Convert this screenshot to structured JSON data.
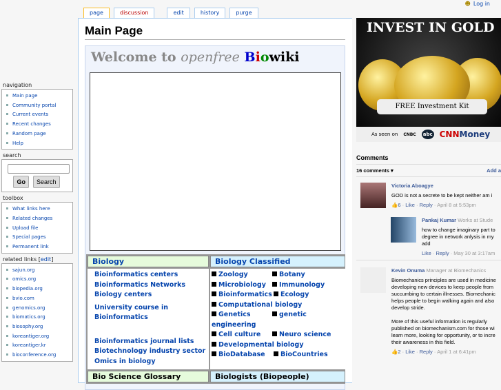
{
  "tabs": {
    "page": "page",
    "discussion": "discussion",
    "edit": "edit",
    "history": "history",
    "purge": "purge"
  },
  "login": "Log in",
  "page_title": "Main Page",
  "welcome": {
    "prefix": "Welcome to ",
    "italic": "openfree",
    "b": "B",
    "i": "i",
    "o": "o",
    "wiki": "wiki"
  },
  "sections": {
    "biology": {
      "title": "Biology",
      "links": [
        "Bioinformatics centers",
        "Bioinformatics Networks",
        "Biology centers",
        "University course in Bioinformatics",
        "Bioinformatics journal lists",
        "Biotechnology industry sector",
        "Omics in biology"
      ]
    },
    "classified": {
      "title": "Biology Classified",
      "links": [
        "Zoology",
        "Botany",
        "Microbiology",
        "Immunology",
        "Bioinformatics",
        "Ecology",
        "Computational biology",
        "Genetics",
        "genetic engineering",
        "Cell culture",
        "Neuro science",
        "Developmental biology",
        "BioDatabase",
        "BioCountries"
      ]
    },
    "glossary": "Bio Science Glossary",
    "biologists": "Biologists (Biopeople)"
  },
  "sidebar": {
    "navigation": {
      "title": "navigation",
      "items": [
        "Main page",
        "Community portal",
        "Current events",
        "Recent changes",
        "Random page",
        "Help"
      ]
    },
    "search": {
      "title": "search",
      "go": "Go",
      "search": "Search"
    },
    "toolbox": {
      "title": "toolbox",
      "items": [
        "What links here",
        "Related changes",
        "Upload file",
        "Special pages",
        "Permanent link"
      ]
    },
    "related": {
      "title": "related links",
      "edit": "edit",
      "items": [
        "sajun.org",
        "omics.org",
        "biopedia.org",
        "bvio.com",
        "genomics.org",
        "biomatics.org",
        "biosophy.org",
        "koreantiger.org",
        "koreantiger.kr",
        "bioconference.org"
      ]
    }
  },
  "ad": {
    "headline": "INVEST IN GOLD",
    "kit": "FREE Investment Kit",
    "seen": "As seen on",
    "cnbc": "CNBC",
    "abc": "abc",
    "cnn": "CNN",
    "money": "Money"
  },
  "comments": {
    "title": "Comments",
    "count": "16 comments",
    "add": "Add a",
    "items": [
      {
        "name": "Victoria Aboagye",
        "sub": "",
        "text": [
          "GOD is not a secrete to be kept neither am i"
        ],
        "likes": "6",
        "like": "Like",
        "reply": "Reply",
        "time": "April 8 at 5:53pm"
      },
      {
        "name": "Pankaj Kumar",
        "sub": "Works at Stude",
        "text": [
          "how to change imaginary part to",
          "degree in network anlysis in my",
          "add"
        ],
        "likes": "",
        "like": "Like",
        "reply": "Reply",
        "time": "May 30 at 3:17am"
      },
      {
        "name": "Kevin Onuma",
        "sub": "Manager at Biomechanics",
        "text": [
          "Biomechanics principles are used in medicine",
          "developing new devices to keep people from",
          "succumbing to certain illnesses. Biomechanic",
          "helps people to begin walking again and also",
          "develop stride.",
          "",
          "More of this useful information is regularly",
          "published on biomechanism.com for those wi",
          "learn more, looking for opportunity, or to incre",
          "their awareness in this field."
        ],
        "likes": "2",
        "like": "Like",
        "reply": "Reply",
        "time": "April 1 at 6:41pm"
      }
    ]
  }
}
